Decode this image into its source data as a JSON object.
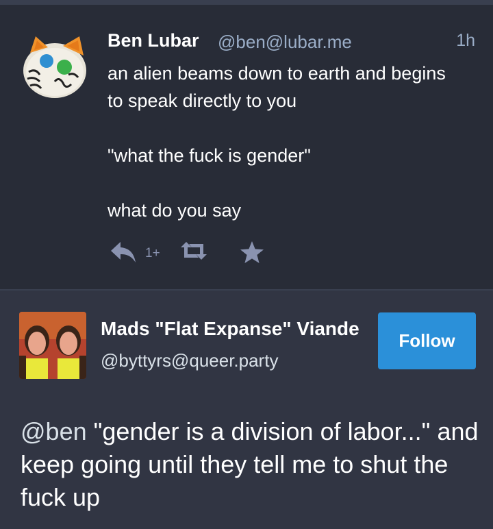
{
  "status": {
    "author_name": "Ben Lubar",
    "author_handle": "@ben@lubar.me",
    "time": "1h",
    "paragraphs": [
      "an alien beams down to earth and begins to speak directly to you",
      "\"what the fuck is gender\"",
      "what do you say"
    ],
    "actions": {
      "reply_icon": "reply-icon",
      "reply_count": "1+",
      "boost_icon": "retweet-icon",
      "favourite_icon": "star-icon"
    }
  },
  "reply": {
    "author_name": "Mads \"Flat Expanse\" Viande",
    "author_handle": "@byttyrs@queer.party",
    "follow_label": "Follow",
    "mention": "@ben",
    "text": " \"gender is a division of labor...\" and keep going until they tell me to shut the fuck up"
  },
  "colors": {
    "background": "#282c37",
    "reply_background": "#313543",
    "accent": "#2b90d9",
    "muted": "#9baec8"
  }
}
